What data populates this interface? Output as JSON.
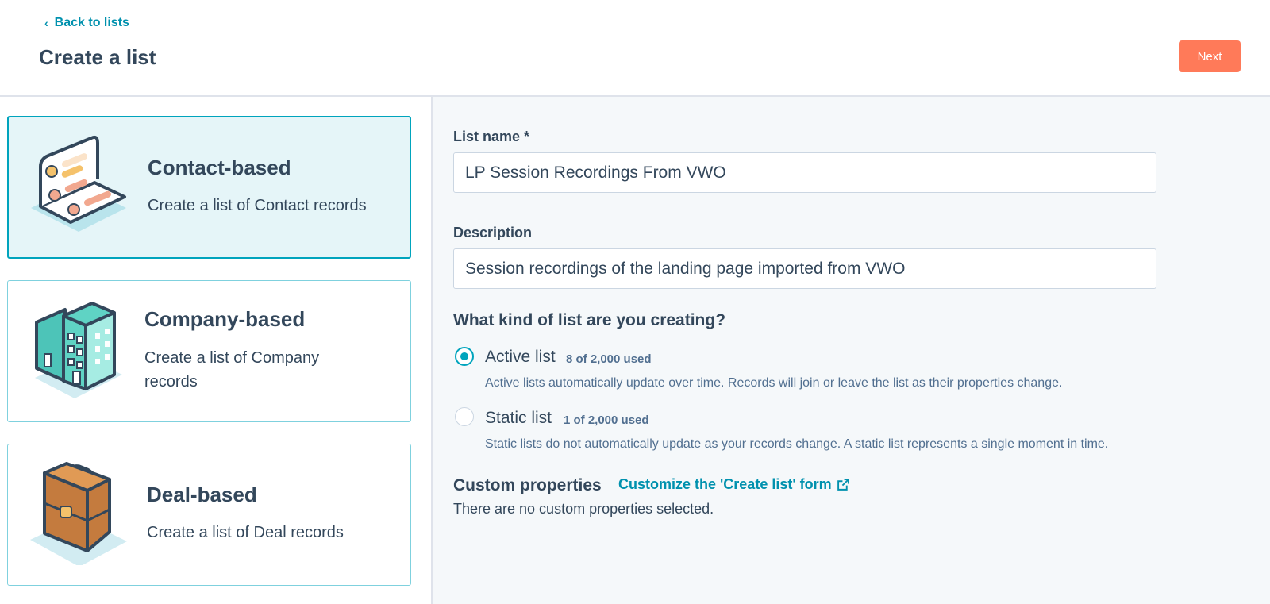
{
  "header": {
    "back_label": "Back to lists",
    "title": "Create a list",
    "next_label": "Next"
  },
  "cards": [
    {
      "title": "Contact-based",
      "desc": "Create a list of Contact records",
      "selected": true,
      "icon": "contact-cards-icon"
    },
    {
      "title": "Company-based",
      "desc_line1": "Create a list of Company",
      "desc_line2": "records",
      "selected": false,
      "icon": "buildings-icon"
    },
    {
      "title": "Deal-based",
      "desc": "Create a list of Deal records",
      "selected": false,
      "icon": "briefcase-icon"
    }
  ],
  "form": {
    "list_name_label": "List name *",
    "list_name_value": "LP Session Recordings From VWO",
    "description_label": "Description",
    "description_value": "Session recordings of the landing page imported from VWO",
    "question": "What kind of list are you creating?",
    "options": [
      {
        "label": "Active list",
        "count": "8 of 2,000 used",
        "help": "Active lists automatically update over time. Records will join or leave the list as their properties change.",
        "checked": true
      },
      {
        "label": "Static list",
        "count": "1 of 2,000 used",
        "help": "Static lists do not automatically update as your records change. A static list represents a single moment in time.",
        "checked": false
      }
    ],
    "custom_properties_title": "Custom properties",
    "custom_properties_link": "Customize the 'Create list' form",
    "custom_properties_empty": "There are no custom properties selected."
  },
  "colors": {
    "accent": "#00a4bd",
    "link": "#0091ae",
    "primary_button": "#ff7a59",
    "text": "#33475b"
  }
}
